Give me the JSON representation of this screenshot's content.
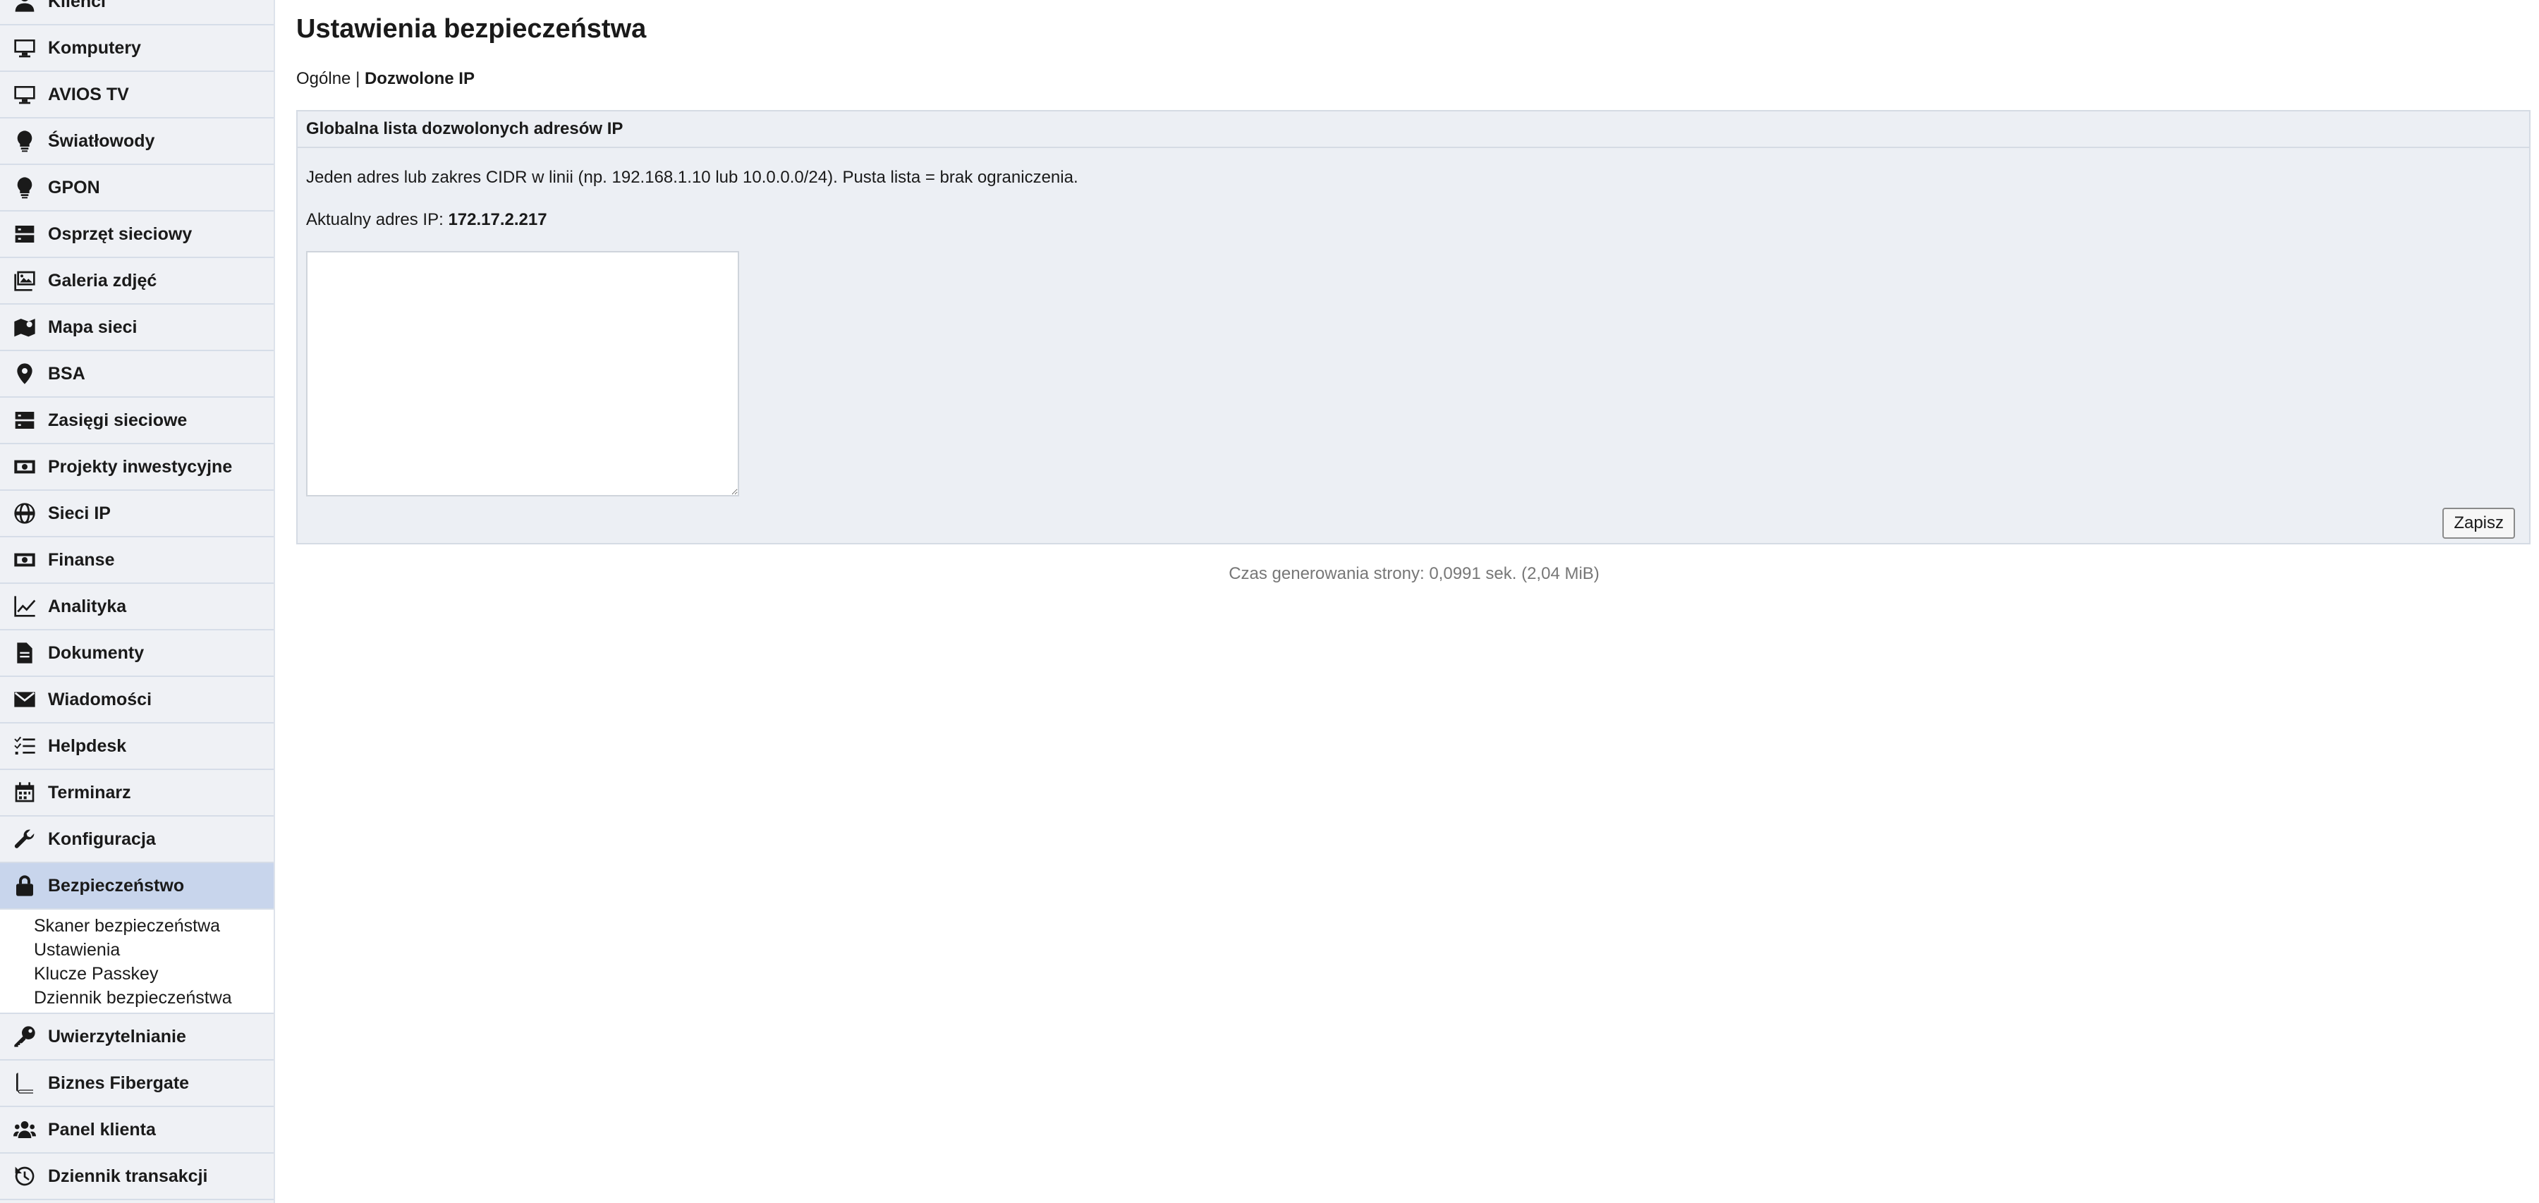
{
  "sidebar": {
    "items": [
      {
        "label": "Klienci",
        "icon": "user-icon"
      },
      {
        "label": "Komputery",
        "icon": "desktop-icon"
      },
      {
        "label": "AVIOS TV",
        "icon": "tv-icon"
      },
      {
        "label": "Światłowody",
        "icon": "lightbulb-icon"
      },
      {
        "label": "GPON",
        "icon": "lightbulb-icon"
      },
      {
        "label": "Osprzęt sieciowy",
        "icon": "server-icon"
      },
      {
        "label": "Galeria zdjęć",
        "icon": "images-icon"
      },
      {
        "label": "Mapa sieci",
        "icon": "map-icon"
      },
      {
        "label": "BSA",
        "icon": "map-pin-icon"
      },
      {
        "label": "Zasięgi sieciowe",
        "icon": "server-icon"
      },
      {
        "label": "Projekty inwestycyjne",
        "icon": "money-icon"
      },
      {
        "label": "Sieci IP",
        "icon": "globe-icon"
      },
      {
        "label": "Finanse",
        "icon": "money-icon"
      },
      {
        "label": "Analityka",
        "icon": "chart-icon"
      },
      {
        "label": "Dokumenty",
        "icon": "document-icon"
      },
      {
        "label": "Wiadomości",
        "icon": "envelope-icon"
      },
      {
        "label": "Helpdesk",
        "icon": "checklist-icon"
      },
      {
        "label": "Terminarz",
        "icon": "calendar-icon"
      },
      {
        "label": "Konfiguracja",
        "icon": "wrench-icon"
      },
      {
        "label": "Bezpieczeństwo",
        "icon": "lock-icon",
        "active": true
      },
      {
        "label": "Uwierzytelnianie",
        "icon": "key-icon"
      },
      {
        "label": "Biznes Fibergate",
        "icon": "book-icon"
      },
      {
        "label": "Panel klienta",
        "icon": "users-icon"
      },
      {
        "label": "Dziennik transakcji",
        "icon": "history-icon"
      }
    ],
    "submenu": [
      "Skaner bezpieczeństwa",
      "Ustawienia",
      "Klucze Passkey",
      "Dziennik bezpieczeństwa"
    ]
  },
  "main": {
    "title": "Ustawienia bezpieczeństwa",
    "tabs": {
      "general": "Ogólne",
      "separator": "|",
      "allowed_ip": "Dozwolone IP"
    },
    "panel": {
      "header": "Globalna lista dozwolonych adresów IP",
      "description": "Jeden adres lub zakres CIDR w linii (np. 192.168.1.10 lub 10.0.0.0/24). Pusta lista = brak ograniczenia.",
      "current_ip_label": "Aktualny adres IP:",
      "current_ip_value": "172.17.2.217",
      "textarea_value": "",
      "save_label": "Zapisz"
    },
    "footer": "Czas generowania strony: 0,0991 sek. (2,04 MiB)"
  },
  "colors": {
    "sidebar_bg": "#eff1f5",
    "sidebar_active_bg": "#c8d5ec",
    "panel_bg": "#eceff4",
    "border": "#d5dbe4",
    "footer_text": "#777777"
  }
}
